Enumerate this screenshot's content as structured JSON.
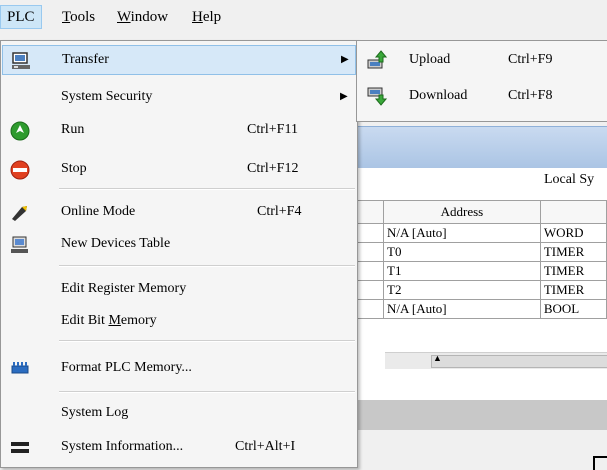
{
  "menubar": {
    "plc": "PLC",
    "tools_prefix": "",
    "tools_ul": "T",
    "tools_rest": "ools",
    "window_ul": "W",
    "window_rest": "indow",
    "help_ul": "H",
    "help_rest": "elp"
  },
  "plc_menu": {
    "transfer": "Transfer",
    "system_security": "System Security",
    "run": "Run",
    "run_sc": "Ctrl+F11",
    "stop": "Stop",
    "stop_sc": "Ctrl+F12",
    "online_mode": "Online Mode",
    "online_mode_sc": "Ctrl+F4",
    "new_devices_table": "New Devices Table",
    "edit_register_memory": "Edit Register Memory",
    "edit_bit_prefix": "Edit Bit ",
    "edit_bit_ul": "M",
    "edit_bit_rest": "emory",
    "format_plc_memory": "Format PLC Memory...",
    "system_log": "System Log",
    "system_information": "System Information...",
    "system_information_sc": "Ctrl+Alt+I"
  },
  "transfer_submenu": {
    "upload": "Upload",
    "upload_sc": "Ctrl+F9",
    "download": "Download",
    "download_sc": "Ctrl+F8"
  },
  "background": {
    "local_sys": "Local Sy",
    "table": {
      "header_address": "Address",
      "rows": [
        {
          "address": "N/A [Auto]",
          "type": "WORD"
        },
        {
          "address": "T0",
          "type": "TIMER"
        },
        {
          "address": "T1",
          "type": "TIMER"
        },
        {
          "address": "T2",
          "type": "TIMER"
        },
        {
          "address": "N/A [Auto]",
          "type": "BOOL"
        }
      ]
    }
  },
  "colors": {
    "highlight": "#d6e8f8",
    "menu_bg": "#f5f5f5",
    "panel_blue": "#aac4e4"
  }
}
